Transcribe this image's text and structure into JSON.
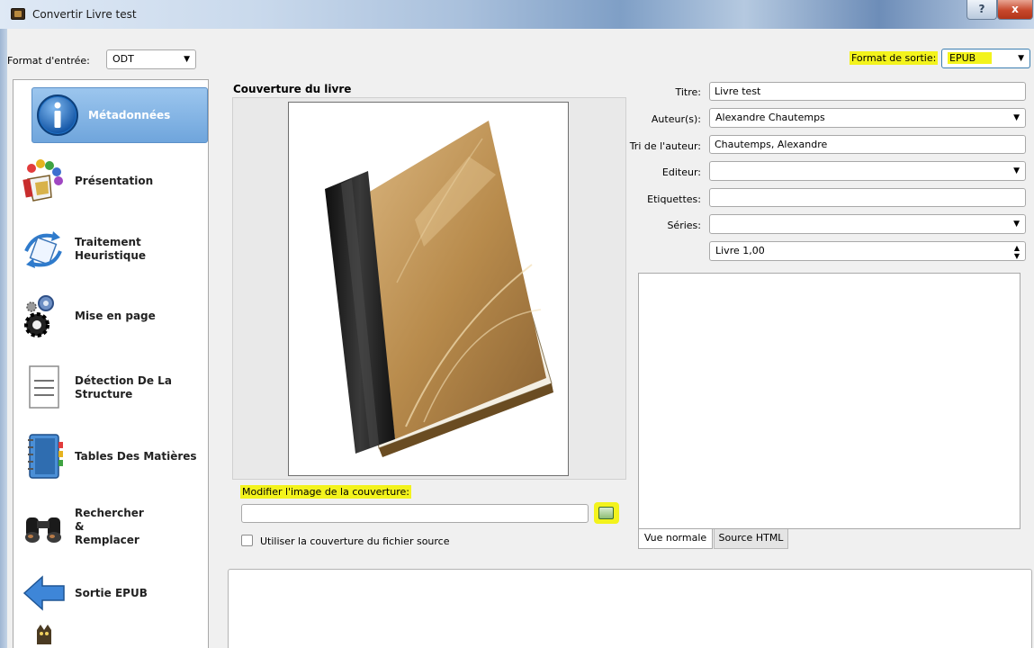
{
  "window": {
    "title": "Convertir Livre test",
    "help_glyph": "?",
    "close_glyph": "x"
  },
  "input_format": {
    "label": "Format d'entrée:",
    "value": "ODT"
  },
  "output_format": {
    "label": "Format de sortie:",
    "value": "EPUB"
  },
  "sidebar": {
    "items": [
      {
        "label": "Métadonnées",
        "icon": "info-icon",
        "selected": true
      },
      {
        "label": "Présentation",
        "icon": "paint-icon"
      },
      {
        "label": "Traitement Heuristique",
        "icon": "heuristic-icon"
      },
      {
        "label": "Mise en page",
        "icon": "gears-icon"
      },
      {
        "label": "Détection De La Structure",
        "icon": "document-icon"
      },
      {
        "label": "Tables Des Matières",
        "icon": "notebook-icon"
      },
      {
        "label": "Rechercher & Remplacer",
        "icon": "binoculars-icon"
      },
      {
        "label": "Sortie EPUB",
        "icon": "arrow-left-icon"
      }
    ]
  },
  "cover": {
    "section_title": "Couverture du livre",
    "modify_label": "Modifier l'image de la couverture:",
    "path_value": "",
    "use_source_label": "Utiliser la couverture du fichier source"
  },
  "metadata": {
    "title_label": "Titre:",
    "title_value": "Livre test",
    "authors_label": "Auteur(s):",
    "authors_value": "Alexandre Chautemps",
    "author_sort_label": "Tri de l'auteur:",
    "author_sort_value": "Chautemps, Alexandre",
    "publisher_label": "Editeur:",
    "publisher_value": "",
    "tags_label": "Etiquettes:",
    "tags_value": "",
    "series_label": "Séries:",
    "series_value": "",
    "series_index_value": "Livre 1,00"
  },
  "editor_tabs": {
    "normal": "Vue normale",
    "html": "Source HTML"
  },
  "colors": {
    "highlight": "#f3f31c",
    "selection": "#6fa5dc"
  }
}
